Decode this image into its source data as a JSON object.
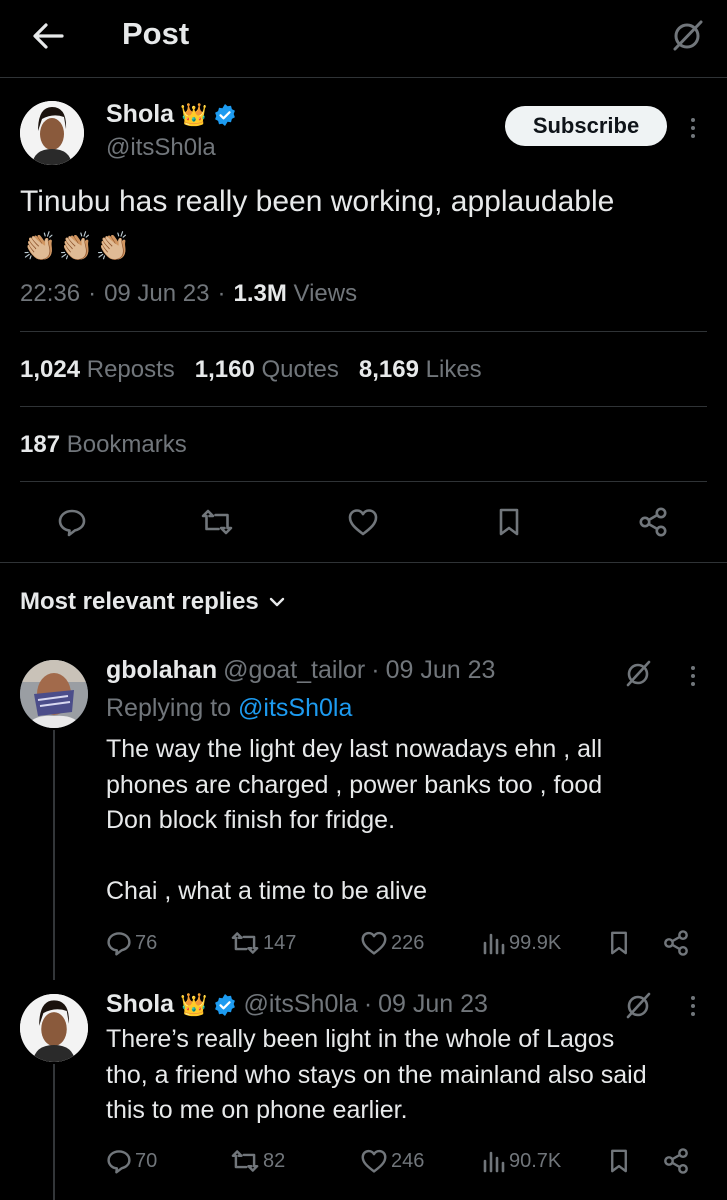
{
  "header": {
    "title": "Post",
    "back_icon": "back-arrow-icon",
    "grok_icon": "grok-icon"
  },
  "post": {
    "author_name": "Shola",
    "author_emoji": "👑",
    "author_handle": "@itsSh0la",
    "subscribe_label": "Subscribe",
    "text": "Tinubu has really been working, applaudable",
    "emoji_line": "👏🏼👏🏼👏🏼",
    "time": "22:36",
    "date": "09 Jun 23",
    "views_count": "1.3M",
    "views_label": "Views",
    "reposts_count": "1,024",
    "reposts_label": "Reposts",
    "quotes_count": "1,160",
    "quotes_label": "Quotes",
    "likes_count": "8,169",
    "likes_label": "Likes",
    "bookmarks_count": "187",
    "bookmarks_label": "Bookmarks"
  },
  "sort": {
    "label": "Most relevant replies"
  },
  "replies": [
    {
      "name": "gbolahan",
      "handle": "@goat_tailor",
      "date": "09 Jun 23",
      "replying_prefix": "Replying to",
      "replying_to": "@itsSh0la",
      "lines": [
        "The way the light dey last nowadays ehn , all",
        "phones are charged , power banks too , food",
        "Don block finish for fridge.",
        "Chai , what a time to be alive"
      ],
      "replies": "76",
      "reposts": "147",
      "likes": "226",
      "views": "99.9K"
    },
    {
      "name": "Shola",
      "emoji": "👑",
      "handle": "@itsSh0la",
      "date": "09 Jun 23",
      "lines": [
        "There’s really been light in the whole of Lagos",
        "tho, a friend who stays on the mainland also said",
        "this to me on phone earlier."
      ],
      "replies": "70",
      "reposts": "82",
      "likes": "246",
      "views": "90.7K"
    }
  ],
  "colors": {
    "background": "#000000",
    "text": "#e7e9ea",
    "muted": "#71767b",
    "accent": "#1d9bf0",
    "divider": "#2f3336"
  }
}
